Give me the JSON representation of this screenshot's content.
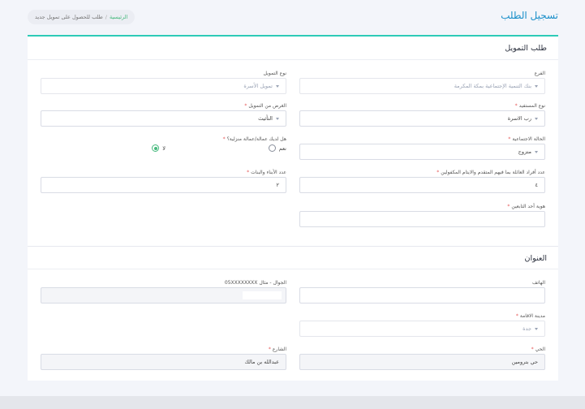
{
  "header": {
    "title": "تسجيل الطلب",
    "breadcrumb": {
      "home": "الرئيسية",
      "separator": "/",
      "current": "طلب للحصول على تمويل جديد"
    }
  },
  "financing": {
    "title": "طلب التمويل",
    "branch": {
      "label": "الفرع",
      "value": "بنك التنمية الإجتماعية بمكة المكرمة"
    },
    "financing_type": {
      "label": "نوع التمويل",
      "value": "تمويل الأسرة"
    },
    "beneficiary_type": {
      "label": "نوع المستفيد",
      "value": "رب الاسرة"
    },
    "purpose": {
      "label": "الغرض من التمويل",
      "value": "التأثيث"
    },
    "social_status": {
      "label": "الحالة الاجتماعية",
      "value": "متزوج"
    },
    "domestic_worker": {
      "label": "هل لديك عمالة/عمالة منزلية؟",
      "yes": "نعم",
      "no": "لا",
      "selected": "no"
    },
    "family_members": {
      "label": "عدد أفراد العائلة بما فيهم المتقدم والايتام المكفولين",
      "value": "٤"
    },
    "children_count": {
      "label": "عدد الأبناء والبنات",
      "value": "٢"
    },
    "dependent_id": {
      "label": "هوية أحد التابعين",
      "value": ""
    }
  },
  "address": {
    "title": "العنوان",
    "phone": {
      "label": "الهاتف",
      "value": ""
    },
    "mobile": {
      "label": "الجوال - مثال 05XXXXXXXX",
      "value": ""
    },
    "city": {
      "label": "مدينة الاقامة",
      "value": "جدة"
    },
    "district": {
      "label": "الحي",
      "value": "حي بترومين"
    },
    "street": {
      "label": "الشارع",
      "value": "عبدالله بن مالك"
    }
  },
  "colors": {
    "accent": "#2ecbb7",
    "title": "#1a8fc9",
    "required": "#e65a5a",
    "radio": "#45b97c"
  }
}
